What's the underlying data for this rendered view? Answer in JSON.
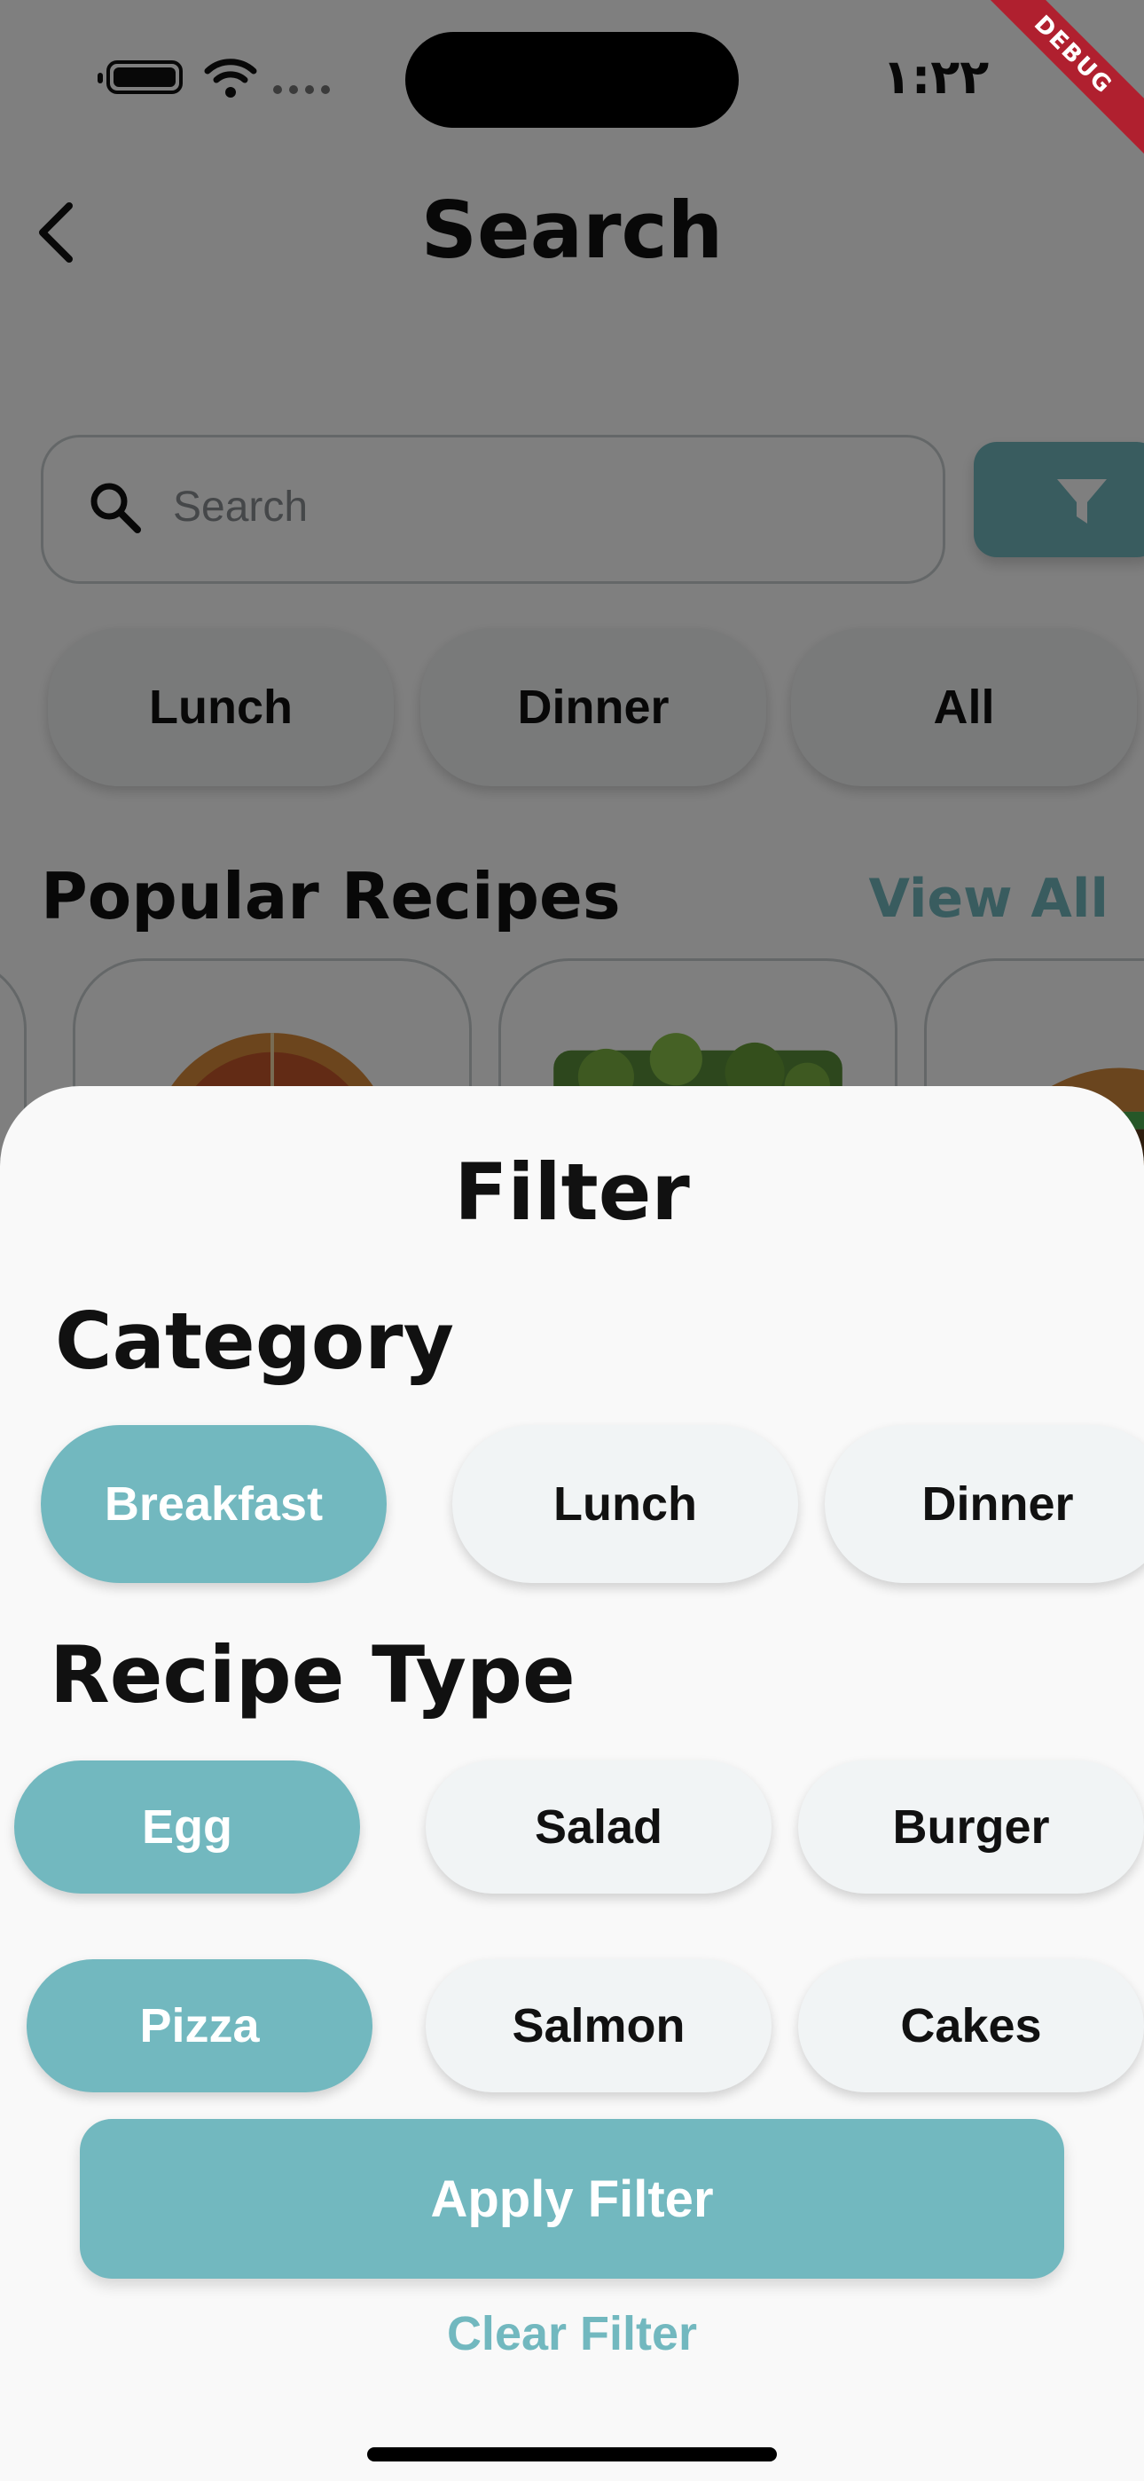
{
  "status_bar": {
    "time": "١:٢٢",
    "debug_label": "DEBUG"
  },
  "header": {
    "title": "Search"
  },
  "search": {
    "placeholder": "Search",
    "value": ""
  },
  "meal_chips": [
    "Lunch",
    "Dinner",
    "All"
  ],
  "popular": {
    "title": "Popular Recipes",
    "view_all": "View All"
  },
  "filter_sheet": {
    "title": "Filter",
    "category": {
      "heading": "Category",
      "options": [
        {
          "label": "Breakfast",
          "selected": true
        },
        {
          "label": "Lunch",
          "selected": false
        },
        {
          "label": "Dinner",
          "selected": false
        }
      ]
    },
    "recipe_type": {
      "heading": "Recipe Type",
      "options": [
        {
          "label": "Egg",
          "selected": true
        },
        {
          "label": "Salad",
          "selected": false
        },
        {
          "label": "Burger",
          "selected": false
        },
        {
          "label": "Pizza",
          "selected": true
        },
        {
          "label": "Salmon",
          "selected": false
        },
        {
          "label": "Cakes",
          "selected": false
        }
      ]
    },
    "apply_label": "Apply Filter",
    "clear_label": "Clear Filter"
  },
  "colors": {
    "accent": "#72b8bf",
    "chip_inactive": "#f1f4f5",
    "sheet_bg": "#f9f9f9",
    "scrim": "rgba(0,0,0,0.5)"
  },
  "icons": {
    "back": "chevron-left-icon",
    "search": "search-icon",
    "filter": "funnel-icon"
  }
}
